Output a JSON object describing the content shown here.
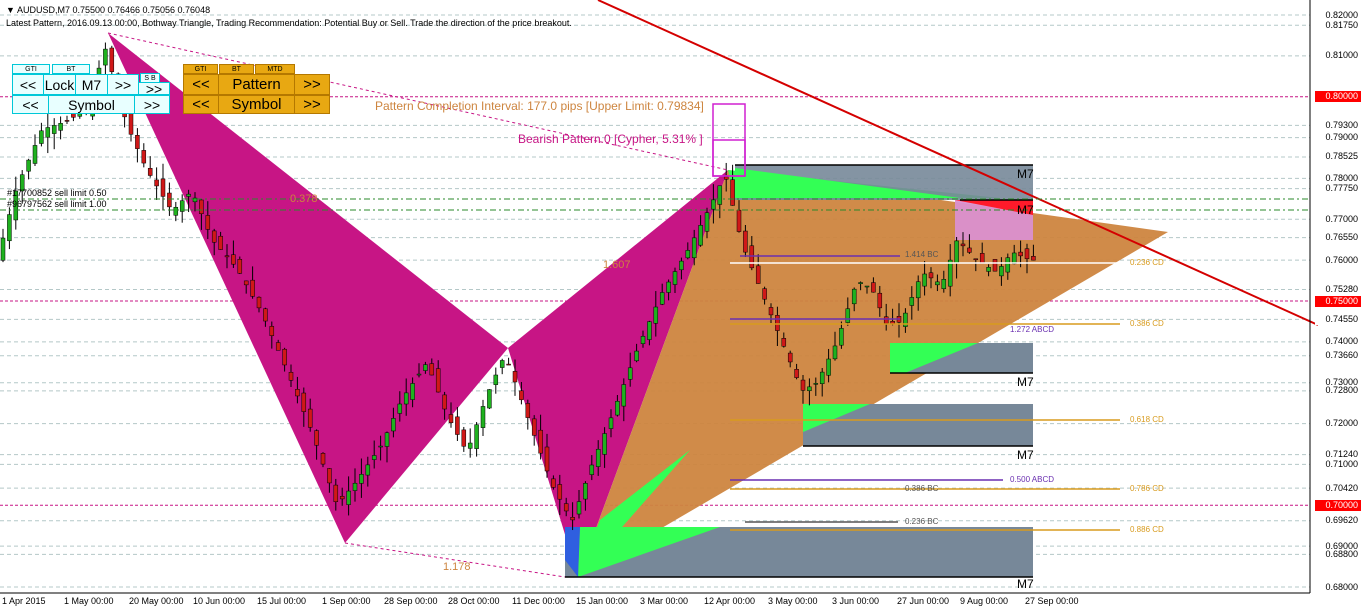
{
  "header": {
    "symbol_line": "AUDUSD,M7  0.75500 0.76466 0.75056 0.76048",
    "pattern_line": "Latest Pattern, 2016.09.13 00:00, Bothway Triangle, Trading Recommendation: Potential Buy or Sell. Trade the direction of the price breakout."
  },
  "panel_left": {
    "tab_gti": "GTI",
    "tab_bt": "BT",
    "tab_sb": "S B",
    "prev": "<<",
    "lock": "Lock",
    "tf": "M7",
    "next": ">>",
    "prev2": "<<",
    "symbol": "Symbol",
    "next2": ">>"
  },
  "panel_right": {
    "tab_gti": "GTI",
    "tab_bt": "BT",
    "tab_mtd": "MTD",
    "prev": "<<",
    "pattern": "Pattern",
    "next": ">>",
    "prev2": "<<",
    "symbol": "Symbol",
    "next2": ">>"
  },
  "annotations": {
    "completion": "Pattern Completion Interval: 177.0 pips [Upper Limit: 0.79834]",
    "bearish": "Bearish Pattern 0  [Cypher,  5.31% ]",
    "order1": "#17700852 sell limit 0.50",
    "order2": "#96797562 sell limit 1.00",
    "ratio_0378": "0.378",
    "ratio_1607": "1.607",
    "ratio_1178": "1.178",
    "fib_1414": "1.414 BC",
    "fib_0236cd": "0.236 CD",
    "fib_1272": "1.272 ABCD",
    "fib_0386cd": "0.386 CD",
    "fib_0618": "0.618 CD",
    "fib_0500abcd": "0.500 ABCD",
    "fib_0786": "0.786 CD",
    "fib_0386bc": "0.386 BC",
    "fib_0236bc": "0.236 BC",
    "fib_0886": "0.886 CD",
    "m7_1": "M7",
    "m7_2": "M7",
    "m7_3": "M7",
    "m7_4": "M7",
    "m7_5": "M7"
  },
  "price_axis": [
    "0.82000",
    "0.81750",
    "0.81000",
    "0.80000",
    "0.79300",
    "0.79000",
    "0.78525",
    "0.78000",
    "0.77750",
    "0.77000",
    "0.76550",
    "0.76000",
    "0.75280",
    "0.75000",
    "0.74550",
    "0.74000",
    "0.73660",
    "0.73000",
    "0.72800",
    "0.72000",
    "0.71240",
    "0.71000",
    "0.70420",
    "0.70000",
    "0.69620",
    "0.69000",
    "0.68800",
    "0.68000"
  ],
  "highlighted_prices": [
    "0.80000",
    "0.75000",
    "0.70000"
  ],
  "time_axis": [
    "1 Apr 2015",
    "1 May 00:00",
    "20 May 00:00",
    "10 Jun 00:00",
    "15 Jul 00:00",
    "1 Sep 00:00",
    "28 Sep 00:00",
    "28 Oct 00:00",
    "11 Dec 00:00",
    "15 Jan 00:00",
    "3 Mar 00:00",
    "12 Apr 00:00",
    "3 May 00:00",
    "3 Jun 00:00",
    "27 Jun 00:00",
    "9 Aug 00:00",
    "27 Sep 00:00"
  ],
  "colors": {
    "bull": "#1fb11f",
    "bear": "#d01818",
    "magenta": "#c71585",
    "orange": "#cd853f",
    "green": "#33ff55",
    "gray": "#778899",
    "trend": "#d40000",
    "grid": "#b4c8c8"
  }
}
